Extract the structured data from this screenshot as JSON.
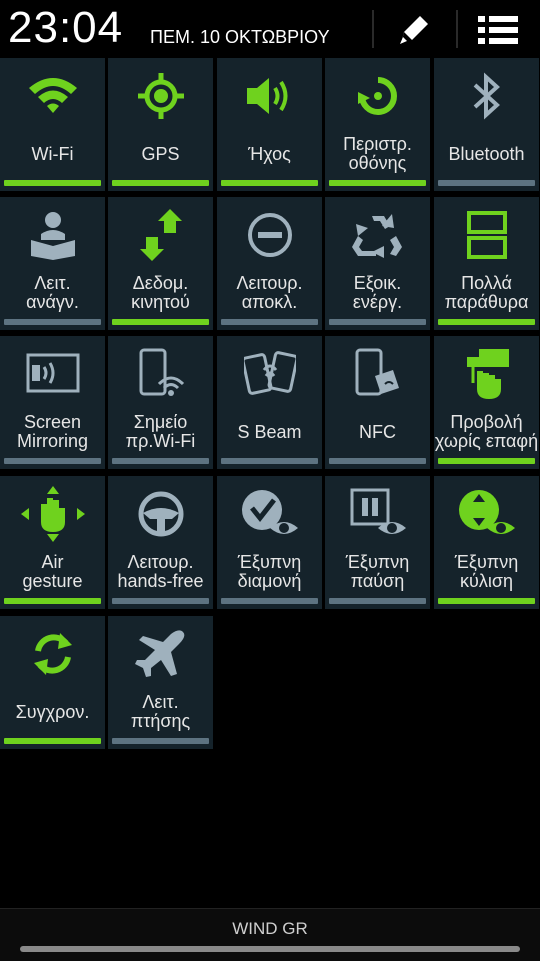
{
  "status": {
    "time": "23:04",
    "date": "ΠΕΜ. 10 ΟΚΤΩΒΡΙΟΥ",
    "edit_icon": "pencil-icon",
    "menu_icon": "list-icon"
  },
  "colors": {
    "active": "#6fd21e",
    "inactive": "#5d7381",
    "tile": "#15232b"
  },
  "tiles": [
    {
      "label": "Wi-Fi",
      "state": "on",
      "icon": "wifi-icon"
    },
    {
      "label": "GPS",
      "state": "on",
      "icon": "gps-icon"
    },
    {
      "label": "Ήχος",
      "state": "on",
      "icon": "speaker-icon"
    },
    {
      "label": "Περιστρ.\nοθόνης",
      "state": "on",
      "icon": "rotate-icon"
    },
    {
      "label": "Bluetooth",
      "state": "off",
      "icon": "bluetooth-icon"
    },
    {
      "label": "Λειτ.\nανάγν.",
      "state": "off",
      "icon": "reading-icon"
    },
    {
      "label": "Δεδομ.\nκινητού",
      "state": "on",
      "icon": "mobile-data-icon"
    },
    {
      "label": "Λειτουρ.\nαποκλ.",
      "state": "off",
      "icon": "block-icon"
    },
    {
      "label": "Εξοικ.\nενέργ.",
      "state": "off",
      "icon": "recycle-icon"
    },
    {
      "label": "Πολλά\nπαράθυρα",
      "state": "on",
      "icon": "multi-window-icon"
    },
    {
      "label": "Screen\nMirroring",
      "state": "off",
      "icon": "screen-mirroring-icon"
    },
    {
      "label": "Σημείο\nπρ.Wi-Fi",
      "state": "off",
      "icon": "hotspot-icon"
    },
    {
      "label": "S Beam",
      "state": "off",
      "icon": "s-beam-icon"
    },
    {
      "label": "NFC",
      "state": "off",
      "icon": "nfc-icon"
    },
    {
      "label": "Προβολή\nχωρίς επαφή",
      "state": "on",
      "icon": "air-view-icon"
    },
    {
      "label": "Air\ngesture",
      "state": "on",
      "icon": "air-gesture-icon"
    },
    {
      "label": "Λειτουρ.\nhands-free",
      "state": "off",
      "icon": "steering-wheel-icon"
    },
    {
      "label": "Έξυπνη\nδιαμονή",
      "state": "off",
      "icon": "smart-stay-icon"
    },
    {
      "label": "Έξυπνη\nπαύση",
      "state": "off",
      "icon": "smart-pause-icon"
    },
    {
      "label": "Έξυπνη\nκύλιση",
      "state": "on",
      "icon": "smart-scroll-icon"
    },
    {
      "label": "Συγχρον.",
      "state": "on",
      "icon": "sync-icon"
    },
    {
      "label": "Λειτ.\nπτήσης",
      "state": "off",
      "icon": "airplane-icon"
    }
  ],
  "footer": {
    "carrier": "WIND GR"
  }
}
